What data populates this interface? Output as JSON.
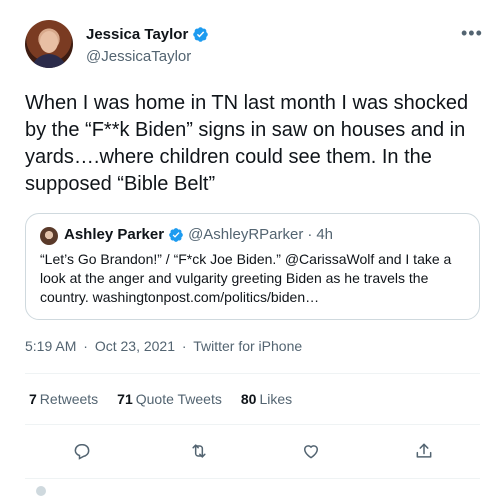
{
  "author": {
    "display_name": "Jessica Taylor",
    "handle": "@JessicaTaylor",
    "verified_icon": "verified-badge-icon"
  },
  "tweet": {
    "text": "When I was home in TN last month I was shocked by the “F**k Biden” signs in saw on houses and in yards….where children could see them. In the supposed “Bible Belt”"
  },
  "quoted_tweet": {
    "display_name": "Ashley Parker",
    "handle": "@AshleyRParker",
    "separator": "·",
    "time": "4h",
    "text": "“Let’s Go Brandon!” / “F*ck Joe Biden.” @CarissaWolf and I take a look at the anger and vulgarity greeting Biden as he travels the country. washingtonpost.com/politics/biden…"
  },
  "meta": {
    "time": "5:19 AM",
    "separator": "·",
    "date": "Oct 23, 2021",
    "source": "Twitter for iPhone"
  },
  "stats": {
    "retweets_count": "7",
    "retweets_label": "Retweets",
    "quotes_count": "71",
    "quotes_label": "Quote Tweets",
    "likes_count": "80",
    "likes_label": "Likes"
  },
  "colors": {
    "text": "#0f1419",
    "secondary": "#536471",
    "verified": "#1d9bf0",
    "border": "#cfd9de"
  }
}
